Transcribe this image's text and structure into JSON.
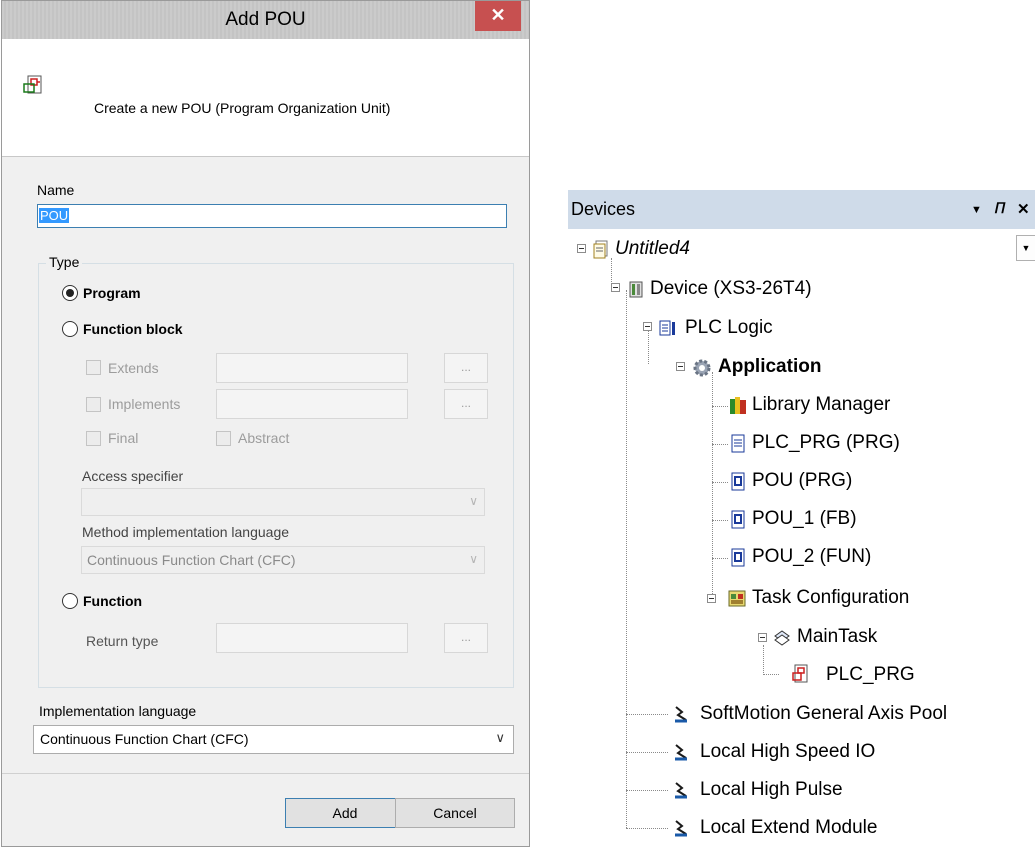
{
  "dialog": {
    "title": "Add POU",
    "close_symbol": "✕",
    "description": "Create a new POU (Program Organization Unit)",
    "name_label": "Name",
    "name_value": "POU",
    "type_group_label": "Type",
    "type_options": {
      "program": "Program",
      "function_block": "Function block",
      "function": "Function"
    },
    "selected_type": "program",
    "extends_label": "Extends",
    "implements_label": "Implements",
    "final_label": "Final",
    "abstract_label": "Abstract",
    "ellipsis": "...",
    "access_specifier_label": "Access specifier",
    "access_specifier_value": "",
    "method_language_label": "Method implementation language",
    "method_language_value": "Continuous Function Chart (CFC)",
    "return_type_label": "Return type",
    "implementation_language_label": "Implementation language",
    "implementation_language_value": "Continuous Function Chart (CFC)",
    "add_button": "Add",
    "cancel_button": "Cancel"
  },
  "devices": {
    "title": "Devices",
    "tree": [
      {
        "label": "Untitled4",
        "icon": "project-icon"
      },
      {
        "label": "Device (XS3-26T4)",
        "icon": "device-icon"
      },
      {
        "label": "PLC Logic",
        "icon": "plc-logic-icon"
      },
      {
        "label": "Application",
        "icon": "application-gear-icon"
      },
      {
        "label": "Library Manager",
        "icon": "library-books-icon"
      },
      {
        "label": "PLC_PRG (PRG)",
        "icon": "program-doc-icon"
      },
      {
        "label": "POU (PRG)",
        "icon": "pou-icon"
      },
      {
        "label": "POU_1 (FB)",
        "icon": "pou-icon"
      },
      {
        "label": "POU_2 (FUN)",
        "icon": "pou-icon"
      },
      {
        "label": "Task Configuration",
        "icon": "task-config-icon"
      },
      {
        "label": "MainTask",
        "icon": "task-icon"
      },
      {
        "label": "PLC_PRG",
        "icon": "cfc-program-icon"
      },
      {
        "label": "SoftMotion General Axis Pool",
        "icon": "module-icon"
      },
      {
        "label": "Local High Speed IO",
        "icon": "module-icon"
      },
      {
        "label": "Local High Pulse",
        "icon": "module-icon"
      },
      {
        "label": "Local Extend Module",
        "icon": "module-icon"
      }
    ]
  },
  "colors": {
    "close_button": "#c75050",
    "devices_header": "#cfdbe9",
    "selection": "#3399ff"
  }
}
